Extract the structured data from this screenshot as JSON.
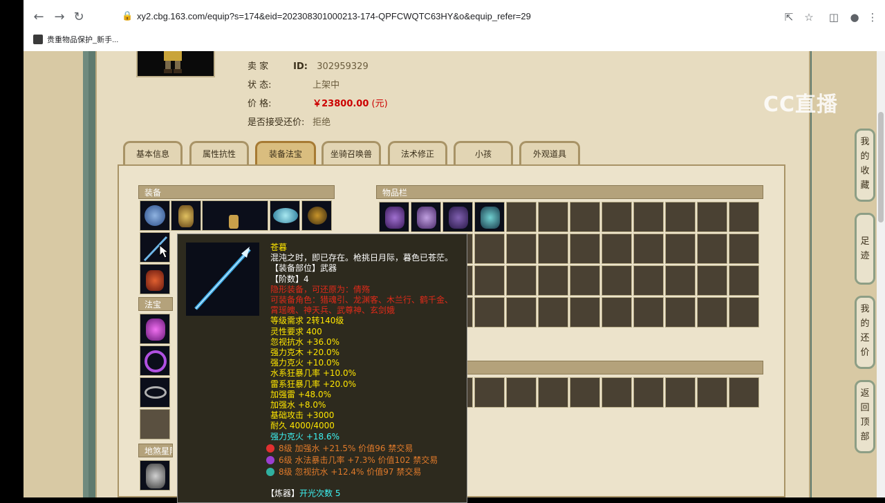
{
  "browser": {
    "url": "xy2.cbg.163.com/equip?s=174&eid=202308301000213-174-QPFCWQTC63HY&o&equip_refer=29",
    "bookmark_label": "贵重物品保护_新手..."
  },
  "watermark": "CC直播",
  "seller": {
    "seller_label": "卖    家",
    "id_label": "ID:",
    "id_value": "302959329",
    "status_label": "状          态:",
    "status_value": "上架中",
    "price_label": "价          格:",
    "price_value": "￥23800.00",
    "price_unit": "(元)",
    "bargain_label": "是否接受还价:",
    "bargain_value": "拒绝"
  },
  "tabs": [
    {
      "label": "基本信息",
      "active": false
    },
    {
      "label": "属性抗性",
      "active": false
    },
    {
      "label": "装备法宝",
      "active": true
    },
    {
      "label": "坐骑召唤兽",
      "active": false
    },
    {
      "label": "法术修正",
      "active": false
    },
    {
      "label": "小孩",
      "active": false
    },
    {
      "label": "外观道具",
      "active": false
    }
  ],
  "sections": {
    "equipment": "装备",
    "treasure": "法宝",
    "star": "地煞星阵",
    "inventory": "物品栏"
  },
  "side_buttons": [
    {
      "label": "我的收藏"
    },
    {
      "label": "足迹"
    },
    {
      "label": "我的还价"
    },
    {
      "label": "返回顶部"
    }
  ],
  "tooltip": {
    "name": "苍暮",
    "desc": "混沌之时，即已存在。枪挑日月际，暮色已苍茫。",
    "slot": "【装备部位】武器",
    "tier": "【阶数】4",
    "restrict1": "隐形装备，可还原为：倩殇",
    "restrict2": "可装备角色：猎魂引、龙渊客、木兰行、鹤千金、",
    "restrict3": "霄瑶魄、神天兵、武尊神、玄剑娥",
    "stats": [
      "等级需求 2转140级",
      "灵性要求 400",
      "忽视抗水 +36.0%",
      "强力克木 +20.0%",
      "强力克火 +10.0%",
      "水系狂暴几率 +10.0%",
      "雷系狂暴几率 +20.0%",
      "加强雷 +48.0%",
      "加强水 +8.0%",
      "基础攻击 +3000",
      "耐久 4000/4000"
    ],
    "cyan_stat": "强力克火 +18.6%",
    "gems": [
      {
        "text": "8级 加强水 +21.5% 价值96 禁交易",
        "color": "#e03030"
      },
      {
        "text": "6级 水法暴击几率 +7.3% 价值102 禁交易",
        "color": "#9a3fd0"
      },
      {
        "text": "8级 忽视抗水 +12.4% 价值97 禁交易",
        "color": "#30b0a0"
      }
    ],
    "refine_label": "【炼器】",
    "refine_value": "开光次数 5"
  }
}
